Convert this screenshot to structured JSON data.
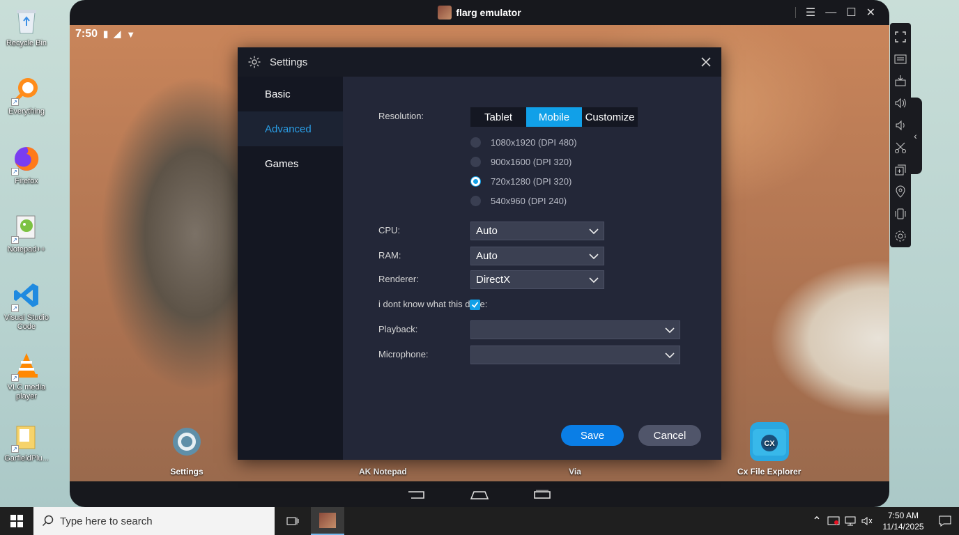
{
  "desktop": {
    "icons": [
      {
        "label": "Recycle Bin",
        "icon": "recycle-bin-icon"
      },
      {
        "label": "Everything",
        "icon": "everything-search-icon"
      },
      {
        "label": "Firefox",
        "icon": "firefox-icon"
      },
      {
        "label": "Notepad++",
        "icon": "notepad-plus-plus-icon"
      },
      {
        "label": "Visual Studio Code",
        "icon": "vscode-icon"
      },
      {
        "label": "VLC media player",
        "icon": "vlc-icon"
      },
      {
        "label": "GarfieldPlu...",
        "icon": "folder-icon"
      }
    ]
  },
  "emulator": {
    "title": "flarg emulator",
    "status_time": "7:50",
    "home_apps": [
      {
        "label": "Settings"
      },
      {
        "label": "AK Notepad"
      },
      {
        "label": "Via"
      },
      {
        "label": "Cx File Explorer"
      }
    ],
    "cx_badge": "CX"
  },
  "settings": {
    "title": "Settings",
    "nav": [
      {
        "label": "Basic"
      },
      {
        "label": "Advanced"
      },
      {
        "label": "Games"
      }
    ],
    "resolution_label": "Resolution:",
    "resolution_tabs": [
      {
        "label": "Tablet"
      },
      {
        "label": "Mobile"
      },
      {
        "label": "Customize"
      }
    ],
    "resolution_options": [
      {
        "label": "1080x1920 (DPI 480)"
      },
      {
        "label": "900x1600 (DPI 320)"
      },
      {
        "label": "720x1280 (DPI 320)"
      },
      {
        "label": "540x960 (DPI 240)"
      }
    ],
    "cpu_label": "CPU:",
    "cpu_value": "Auto",
    "ram_label": "RAM:",
    "ram_value": "Auto",
    "renderer_label": "Renderer:",
    "renderer_value": "DirectX",
    "checkbox_label": "i dont know what this d",
    "checkbox_trail": "e:",
    "playback_label": "Playback:",
    "playback_value": "",
    "microphone_label": "Microphone:",
    "microphone_value": "",
    "save_label": "Save",
    "cancel_label": "Cancel"
  },
  "taskbar": {
    "search_placeholder": "Type here to search",
    "time": "7:50 AM",
    "date": "11/14/2025"
  },
  "colors": {
    "accent": "#11a0e8",
    "save_button": "#0a7ee6",
    "dialog_bg": "#232738"
  }
}
